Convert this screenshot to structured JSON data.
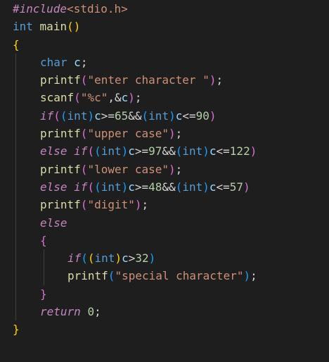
{
  "editor": {
    "language": "c",
    "lines": [
      {
        "indent": 0,
        "tokens": [
          {
            "t": "#include",
            "c": "ctl"
          },
          {
            "t": "<stdio.h>",
            "c": "str"
          }
        ]
      },
      {
        "indent": 0,
        "tokens": [
          {
            "t": "int",
            "c": "kw"
          },
          {
            "t": " ",
            "c": "op"
          },
          {
            "t": "main",
            "c": "fn"
          },
          {
            "t": "()",
            "c": "brk1"
          }
        ]
      },
      {
        "indent": 0,
        "tokens": [
          {
            "t": "{",
            "c": "brk1"
          }
        ]
      },
      {
        "indent": 1,
        "tokens": [
          {
            "t": "char",
            "c": "kw"
          },
          {
            "t": " ",
            "c": "op"
          },
          {
            "t": "c",
            "c": "var"
          },
          {
            "t": ";",
            "c": "op"
          }
        ]
      },
      {
        "indent": 1,
        "tokens": [
          {
            "t": "printf",
            "c": "fn"
          },
          {
            "t": "(",
            "c": "brk2"
          },
          {
            "t": "\"enter character \"",
            "c": "str"
          },
          {
            "t": ")",
            "c": "brk2"
          },
          {
            "t": ";",
            "c": "op"
          }
        ]
      },
      {
        "indent": 1,
        "tokens": [
          {
            "t": "scanf",
            "c": "fn"
          },
          {
            "t": "(",
            "c": "brk2"
          },
          {
            "t": "\"%c\"",
            "c": "str"
          },
          {
            "t": ",&",
            "c": "op"
          },
          {
            "t": "c",
            "c": "var"
          },
          {
            "t": ")",
            "c": "brk2"
          },
          {
            "t": ";",
            "c": "op"
          }
        ]
      },
      {
        "indent": 1,
        "tokens": [
          {
            "t": "if",
            "c": "ctl"
          },
          {
            "t": "(",
            "c": "brk2"
          },
          {
            "t": "(",
            "c": "brk3"
          },
          {
            "t": "int",
            "c": "kw"
          },
          {
            "t": ")",
            "c": "brk3"
          },
          {
            "t": "c",
            "c": "var"
          },
          {
            "t": ">=",
            "c": "op"
          },
          {
            "t": "65",
            "c": "num"
          },
          {
            "t": "&&",
            "c": "op"
          },
          {
            "t": "(",
            "c": "brk3"
          },
          {
            "t": "int",
            "c": "kw"
          },
          {
            "t": ")",
            "c": "brk3"
          },
          {
            "t": "c",
            "c": "var"
          },
          {
            "t": "<=",
            "c": "op"
          },
          {
            "t": "90",
            "c": "num"
          },
          {
            "t": ")",
            "c": "brk2"
          }
        ]
      },
      {
        "indent": 1,
        "tokens": [
          {
            "t": "printf",
            "c": "fn"
          },
          {
            "t": "(",
            "c": "brk2"
          },
          {
            "t": "\"upper case\"",
            "c": "str"
          },
          {
            "t": ")",
            "c": "brk2"
          },
          {
            "t": ";",
            "c": "op"
          }
        ]
      },
      {
        "indent": 1,
        "tokens": [
          {
            "t": "else",
            "c": "ctl"
          },
          {
            "t": " ",
            "c": "op"
          },
          {
            "t": "if",
            "c": "ctl"
          },
          {
            "t": "(",
            "c": "brk2"
          },
          {
            "t": "(",
            "c": "brk3"
          },
          {
            "t": "int",
            "c": "kw"
          },
          {
            "t": ")",
            "c": "brk3"
          },
          {
            "t": "c",
            "c": "var"
          },
          {
            "t": ">=",
            "c": "op"
          },
          {
            "t": "97",
            "c": "num"
          },
          {
            "t": "&&",
            "c": "op"
          },
          {
            "t": "(",
            "c": "brk3"
          },
          {
            "t": "int",
            "c": "kw"
          },
          {
            "t": ")",
            "c": "brk3"
          },
          {
            "t": "c",
            "c": "var"
          },
          {
            "t": "<=",
            "c": "op"
          },
          {
            "t": "122",
            "c": "num"
          },
          {
            "t": ")",
            "c": "brk2"
          }
        ]
      },
      {
        "indent": 1,
        "tokens": [
          {
            "t": "printf",
            "c": "fn"
          },
          {
            "t": "(",
            "c": "brk2"
          },
          {
            "t": "\"lower case\"",
            "c": "str"
          },
          {
            "t": ")",
            "c": "brk2"
          },
          {
            "t": ";",
            "c": "op"
          }
        ]
      },
      {
        "indent": 1,
        "tokens": [
          {
            "t": "else",
            "c": "ctl"
          },
          {
            "t": " ",
            "c": "op"
          },
          {
            "t": "if",
            "c": "ctl"
          },
          {
            "t": "(",
            "c": "brk2"
          },
          {
            "t": "(",
            "c": "brk3"
          },
          {
            "t": "int",
            "c": "kw"
          },
          {
            "t": ")",
            "c": "brk3"
          },
          {
            "t": "c",
            "c": "var"
          },
          {
            "t": ">=",
            "c": "op"
          },
          {
            "t": "48",
            "c": "num"
          },
          {
            "t": "&&",
            "c": "op"
          },
          {
            "t": "(",
            "c": "brk3"
          },
          {
            "t": "int",
            "c": "kw"
          },
          {
            "t": ")",
            "c": "brk3"
          },
          {
            "t": "c",
            "c": "var"
          },
          {
            "t": "<=",
            "c": "op"
          },
          {
            "t": "57",
            "c": "num"
          },
          {
            "t": ")",
            "c": "brk2"
          }
        ]
      },
      {
        "indent": 1,
        "tokens": [
          {
            "t": "printf",
            "c": "fn"
          },
          {
            "t": "(",
            "c": "brk2"
          },
          {
            "t": "\"digit\"",
            "c": "str"
          },
          {
            "t": ")",
            "c": "brk2"
          },
          {
            "t": ";",
            "c": "op"
          }
        ]
      },
      {
        "indent": 1,
        "tokens": [
          {
            "t": "else",
            "c": "ctl"
          }
        ]
      },
      {
        "indent": 1,
        "tokens": [
          {
            "t": "{",
            "c": "brk2"
          }
        ]
      },
      {
        "indent": 2,
        "tokens": [
          {
            "t": "if",
            "c": "ctl"
          },
          {
            "t": "(",
            "c": "brk3"
          },
          {
            "t": "(",
            "c": "brk1"
          },
          {
            "t": "int",
            "c": "kw"
          },
          {
            "t": ")",
            "c": "brk1"
          },
          {
            "t": "c",
            "c": "var"
          },
          {
            "t": ">",
            "c": "op"
          },
          {
            "t": "32",
            "c": "num"
          },
          {
            "t": ")",
            "c": "brk3"
          }
        ]
      },
      {
        "indent": 2,
        "tokens": [
          {
            "t": "printf",
            "c": "fn"
          },
          {
            "t": "(",
            "c": "brk3"
          },
          {
            "t": "\"special character\"",
            "c": "str"
          },
          {
            "t": ")",
            "c": "brk3"
          },
          {
            "t": ";",
            "c": "op"
          }
        ]
      },
      {
        "indent": 1,
        "tokens": [
          {
            "t": "}",
            "c": "brk2"
          }
        ]
      },
      {
        "indent": 1,
        "tokens": [
          {
            "t": "return",
            "c": "ctl"
          },
          {
            "t": " ",
            "c": "op"
          },
          {
            "t": "0",
            "c": "num"
          },
          {
            "t": ";",
            "c": "op"
          }
        ]
      },
      {
        "indent": 0,
        "tokens": [
          {
            "t": "}",
            "c": "brk1"
          }
        ]
      }
    ]
  },
  "colors": {
    "background": "#1e1e1e",
    "default_text": "#d4d4d4",
    "keyword": "#569cd6",
    "control": "#c586c0",
    "function": "#dcdcaa",
    "string": "#ce9178",
    "number": "#b5cea8",
    "variable": "#9cdcfe",
    "bracket_1": "#ffd700",
    "bracket_2": "#da70d6",
    "bracket_3": "#179fff",
    "indent_guide": "#404040"
  }
}
